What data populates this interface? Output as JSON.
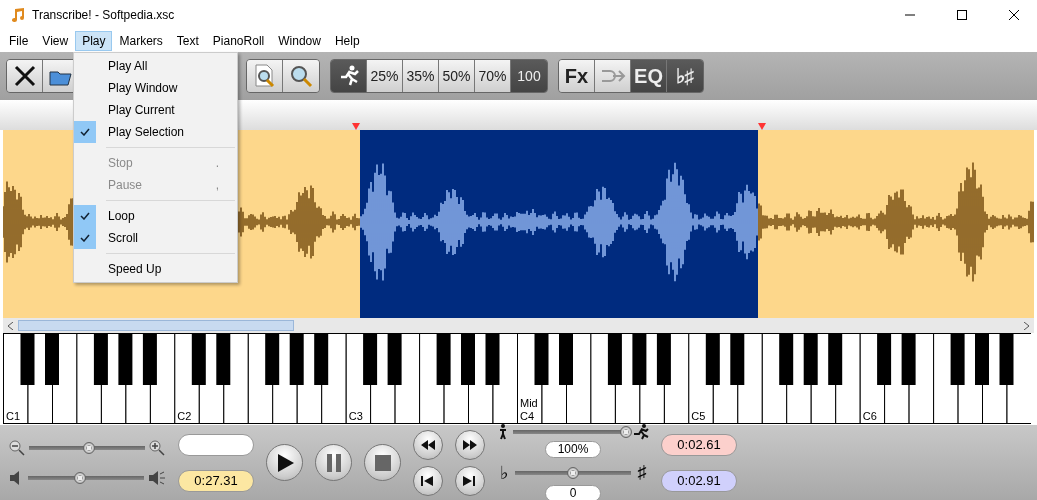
{
  "window": {
    "title": "Transcribe! - Softpedia.xsc"
  },
  "menu_bar": [
    {
      "label": "File",
      "selected": false
    },
    {
      "label": "View",
      "selected": false
    },
    {
      "label": "Play",
      "selected": true
    },
    {
      "label": "Markers",
      "selected": false
    },
    {
      "label": "Text",
      "selected": false
    },
    {
      "label": "PianoRoll",
      "selected": false
    },
    {
      "label": "Window",
      "selected": false
    },
    {
      "label": "Help",
      "selected": false
    }
  ],
  "play_menu": [
    {
      "kind": "item",
      "label": "Play All",
      "checked": false,
      "disabled": false
    },
    {
      "kind": "item",
      "label": "Play Window",
      "checked": false,
      "disabled": false
    },
    {
      "kind": "item",
      "label": "Play Current",
      "checked": false,
      "disabled": false
    },
    {
      "kind": "item",
      "label": "Play Selection",
      "checked": true,
      "disabled": false
    },
    {
      "kind": "separator"
    },
    {
      "kind": "item",
      "label": "Stop",
      "shortcut": ".",
      "checked": false,
      "disabled": true
    },
    {
      "kind": "item",
      "label": "Pause",
      "shortcut": ",",
      "checked": false,
      "disabled": true
    },
    {
      "kind": "separator"
    },
    {
      "kind": "item",
      "label": "Loop",
      "checked": true,
      "disabled": false
    },
    {
      "kind": "item",
      "label": "Scroll",
      "checked": true,
      "disabled": false
    },
    {
      "kind": "separator"
    },
    {
      "kind": "item",
      "label": "Speed Up",
      "checked": false,
      "disabled": false
    }
  ],
  "toolbar": {
    "speed_buttons": [
      {
        "label": "25%",
        "selected": false
      },
      {
        "label": "35%",
        "selected": false
      },
      {
        "label": "50%",
        "selected": false
      },
      {
        "label": "70%",
        "selected": false
      },
      {
        "label": "100",
        "selected": true
      }
    ],
    "effect_buttons": [
      {
        "kind": "text",
        "label": "Fx",
        "on": false
      },
      {
        "kind": "icon",
        "on": false
      },
      {
        "kind": "text",
        "label": "EQ",
        "on": true
      },
      {
        "kind": "text",
        "label": "♭♯",
        "on": true
      }
    ]
  },
  "keyboard": {
    "octave_labels": [
      "C1",
      "C2",
      "C3",
      "C4",
      "C5",
      "C6"
    ],
    "middle_label": "Mid"
  },
  "controls": {
    "zoom_slider": {
      "level": 0.52
    },
    "volume_slider": {
      "level": 0.45
    },
    "position_time": "0:27.31",
    "speed_slider": {
      "level": 0.97
    },
    "speed_reading": "100%",
    "pitch_slider": {
      "level": 0.5
    },
    "pitch_reading": "0",
    "flat_symbol": "♭",
    "sharp_symbol": "♯",
    "loop_start": "0:02.61",
    "loop_end": "0:02.91"
  }
}
